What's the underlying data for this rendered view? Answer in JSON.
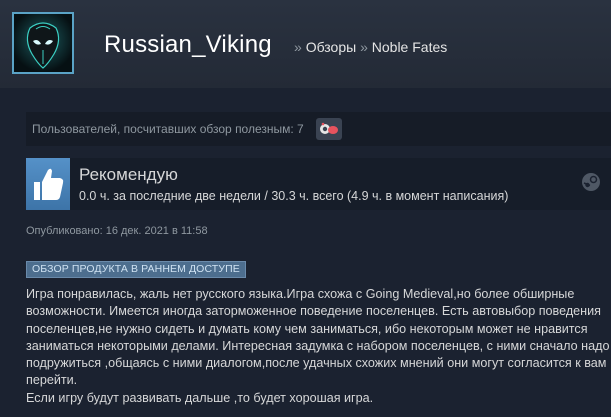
{
  "header": {
    "persona_name": "Russian_Viking",
    "crumb_sep": "»",
    "crumb_reviews": "Обзоры",
    "crumb_game": "Noble Fates"
  },
  "helpful": {
    "text": "Пользователей, посчитавших обзор полезным: 7"
  },
  "recommendation": {
    "title": "Рекомендую",
    "hours": "0.0 ч. за последние две недели / 30.3 ч. всего (4.9 ч. в момент написания)"
  },
  "posted": "Опубликовано: 16 дек. 2021 в 11:58",
  "early_access_badge": "ОБЗОР ПРОДУКТА В РАННЕМ ДОСТУПЕ",
  "review": {
    "paragraph1": "Игра понравилась, жаль нет русского языка.Игра схожа с Going Medieval,но более обширные возможности. Имеется иногда заторможенное поведение поселенцев. Есть автовыбор поведения поселенцев,не нужно сидеть и думать кому чем заниматься, ибо некоторым может не нравится заниматься некоторыми делами. Интересная задумка с набором поселенцев, с ними сначало надо подружиться ,общаясь с ними диалогом,после удачных схожих мнений они могут согласится к вам перейти.",
    "paragraph2": "Если игру будут развивать дальше ,то будет хорошая игра."
  },
  "icons": {
    "avatar": "alien-mask-avatar",
    "award": "award-icon",
    "thumb": "thumbs-up-icon",
    "platform": "steam-icon"
  },
  "colors": {
    "background": "#1b2230",
    "persona": "#ffffff",
    "text": "#d6d7d8",
    "muted": "#8f98a0",
    "thumb_blue": "#4a86bd",
    "badge": "#4d6e8e",
    "avatar_border": "#5aa3c6"
  }
}
